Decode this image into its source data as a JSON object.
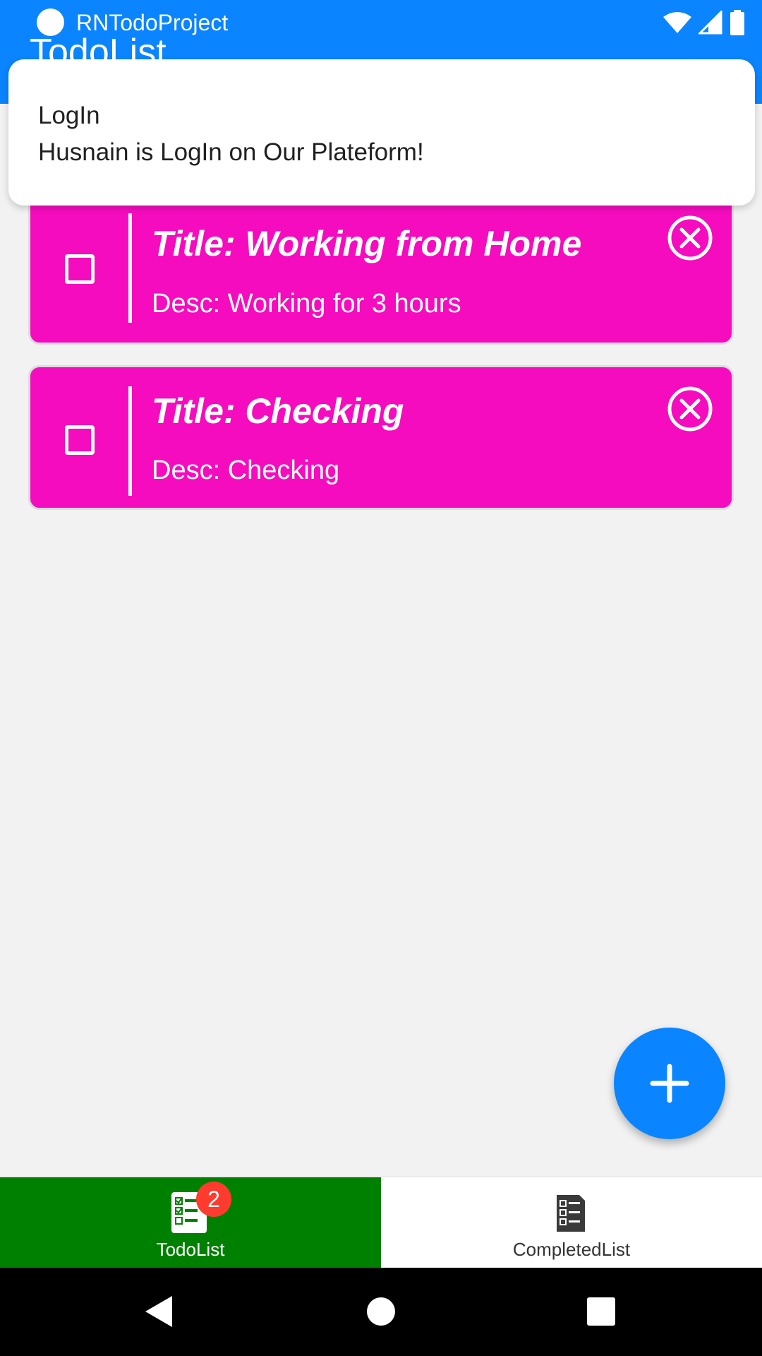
{
  "status_bar": {
    "app_name": "RNTodoProject"
  },
  "header": {
    "title": "TodoList"
  },
  "notification": {
    "title": "LogIn",
    "body": "Husnain is LogIn on Our Plateform!"
  },
  "todos": [
    {
      "title": "Title: Working from Home",
      "desc": "Desc: Working for 3 hours",
      "checked": false
    },
    {
      "title": "Title: Checking",
      "desc": "Desc: Checking",
      "checked": false
    }
  ],
  "fab": {
    "icon": "plus-icon"
  },
  "tabs": [
    {
      "label": "TodoList",
      "icon": "checklist-icon",
      "badge": "2",
      "active": true
    },
    {
      "label": "CompletedList",
      "icon": "document-checklist-icon",
      "active": false
    }
  ],
  "colors": {
    "header_blue": "#0a84ff",
    "card_magenta": "#f50cbf",
    "active_tab_green": "#008000",
    "badge_red": "#ff3b30",
    "background": "#f2f2f2"
  }
}
